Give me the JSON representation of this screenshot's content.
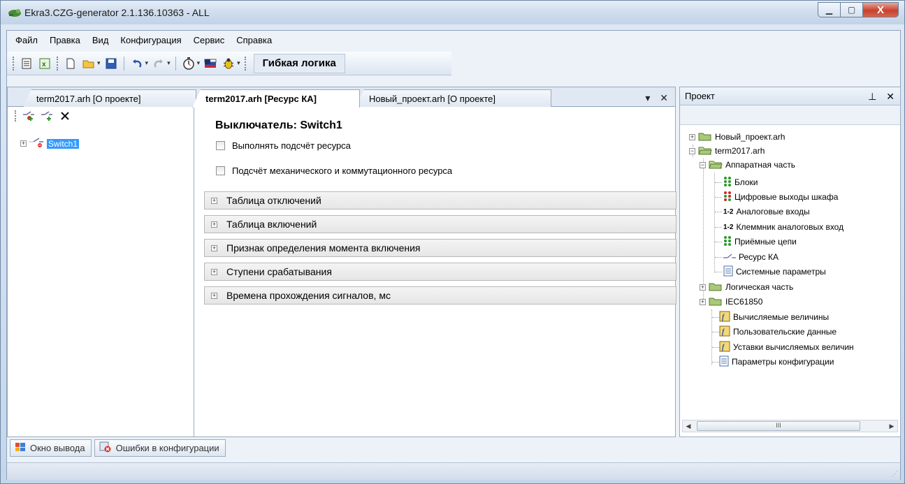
{
  "window": {
    "title": "Ekra3.CZG-generator 2.1.136.10363 - ALL",
    "buttons": {
      "minimize": "▁",
      "maximize": "▢",
      "close": "X"
    }
  },
  "menu": [
    "Файл",
    "Правка",
    "Вид",
    "Конфигурация",
    "Сервис",
    "Справка"
  ],
  "toolbar": {
    "flex_logic_label": "Гибкая логика"
  },
  "document_tabs": [
    {
      "label": "term2017.arh [О проекте]",
      "active": false
    },
    {
      "label": "term2017.arh [Ресурс КА]",
      "active": true
    },
    {
      "label": "Новый_проект.arh [О проекте]",
      "active": false
    }
  ],
  "tab_controls": {
    "dropdown": "▾",
    "close": "✕"
  },
  "left_tree": {
    "selected_node": "Switch1"
  },
  "breaker": {
    "title": "Выключатель: Switch1",
    "checkboxes": [
      {
        "label": "Выполнять подсчёт ресурса",
        "checked": false
      },
      {
        "label": "Подсчёт механического и коммутационного ресурса",
        "checked": false
      }
    ],
    "sections": [
      "Таблица отключений",
      "Таблица включений",
      "Признак определения момента включения",
      "Ступени срабатывания",
      "Времена прохождения сигналов, мс"
    ]
  },
  "project_panel": {
    "title": "Проект",
    "pin": "⊥",
    "close": "✕",
    "tree": [
      "Новый_проект.arh",
      "term2017.arh",
      "Аппаратная часть",
      "Блоки",
      "Цифровые выходы шкафа",
      "Аналоговые входы",
      "Клеммник аналоговых вход",
      "Приёмные цепи",
      "Ресурс КА",
      "Системные параметры",
      "Логическая часть",
      "IEC61850",
      "Вычисляемые величины",
      "Пользовательские данные",
      "Уставки вычисляемых величин",
      "Параметры конфигурации"
    ],
    "scroll_grip": "III"
  },
  "bottom_tabs": [
    "Окно вывода",
    "Ошибки в конфигурации"
  ],
  "colors": {
    "selection": "#3399ff",
    "accent": "#c7412d"
  }
}
